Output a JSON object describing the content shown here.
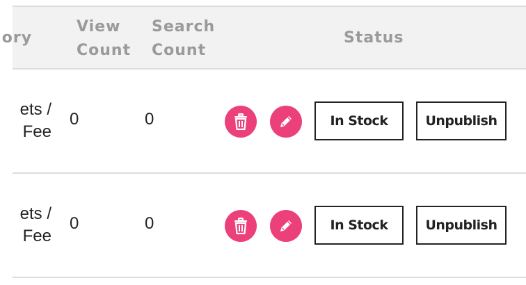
{
  "table": {
    "headers": {
      "category": "gory",
      "view_count_line1": "View",
      "view_count_line2": "Count",
      "search_count_line1": "Search",
      "search_count_line2": "Count",
      "status": "Status"
    },
    "rows": [
      {
        "category_line1": "ets /",
        "category_line2": "Fee",
        "view_count": "0",
        "search_count": "0",
        "stock_label": "In Stock",
        "publish_label": "Unpublish"
      },
      {
        "category_line1": "ets /",
        "category_line2": "Fee",
        "view_count": "0",
        "search_count": "0",
        "stock_label": "In Stock",
        "publish_label": "Unpublish"
      }
    ]
  },
  "icons": {
    "delete": "trash-icon",
    "edit": "pencil-icon"
  },
  "colors": {
    "accent": "#ec407a",
    "header_background": "#f2f2f2",
    "header_text": "#9a9a9a",
    "border": "#dcdcdc",
    "button_border": "#222222"
  }
}
